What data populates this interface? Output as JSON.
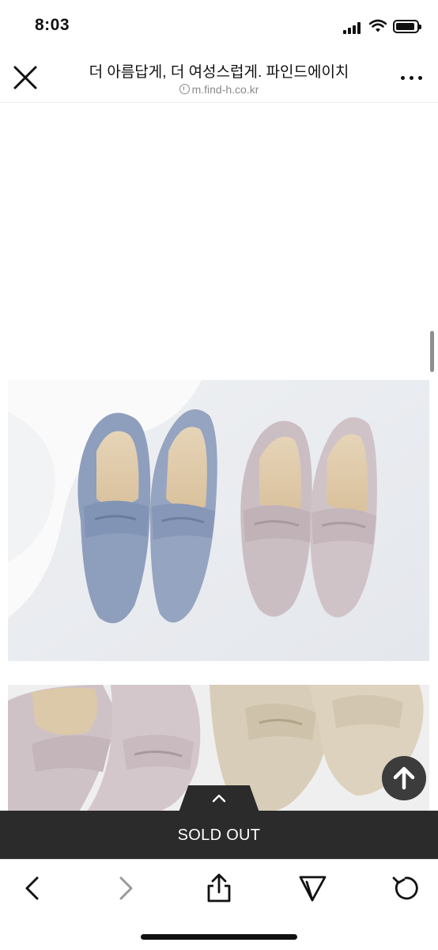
{
  "status": {
    "time": "8:03"
  },
  "header": {
    "title": "더 아름답게, 더 여성스럽게. 파인드에이치",
    "url": "m.find-h.co.kr"
  },
  "content": {
    "images": [
      {
        "name": "blue and pink suede penny loafers"
      },
      {
        "name": "pink and beige suede penny loafers"
      }
    ],
    "colors": {
      "blue_suede": "#8f9fbd",
      "pink_suede": "#c9bcc0",
      "beige_suede": "#d7cbb6"
    }
  },
  "purchase_bar": {
    "label": "SOLD OUT",
    "background": "#2b2b2b"
  },
  "toolbar": {
    "icons": [
      "back-icon",
      "forward-icon",
      "share-icon",
      "send-icon",
      "refresh-icon"
    ]
  }
}
